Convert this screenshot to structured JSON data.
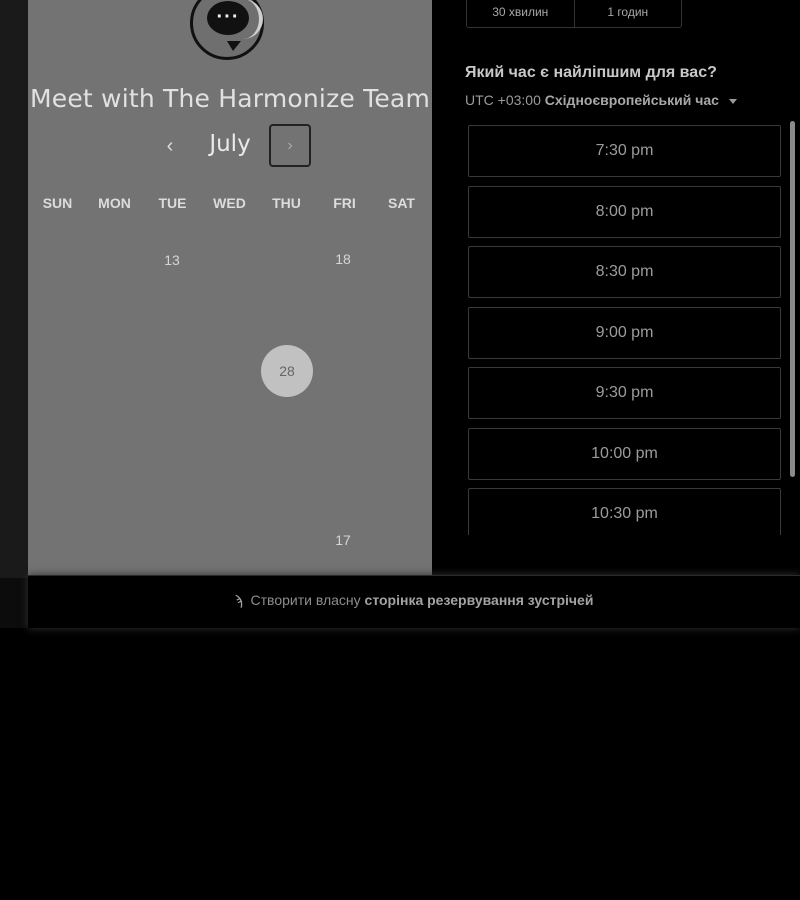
{
  "calendar": {
    "title": "Meet with The Harmonize Team",
    "month": "July",
    "prev_glyph": "‹",
    "next_glyph": "›",
    "weekdays": [
      "SUN",
      "MON",
      "TUE",
      "WED",
      "THU",
      "FRI",
      "SAT"
    ],
    "days": [
      "13",
      "18",
      "28",
      "17"
    ],
    "selected_day": "28",
    "logo_icon": "chat-bubble-icon"
  },
  "durations": [
    "30 хвилин",
    "1 годин"
  ],
  "time_picker": {
    "question": "Який час є найліпшим для вас?",
    "timezone_prefix": "UTC +03:00",
    "timezone_name": "Східноєвропейський час",
    "slots": [
      "7:30 pm",
      "8:00 pm",
      "8:30 pm",
      "9:00 pm",
      "9:30 pm",
      "10:00 pm",
      "10:30 pm"
    ]
  },
  "footer": {
    "icon": "sprocket-icon",
    "icon_glyph": "ϡ",
    "prefix": "Створити власну",
    "link": "сторінка резервування зустрічей"
  }
}
